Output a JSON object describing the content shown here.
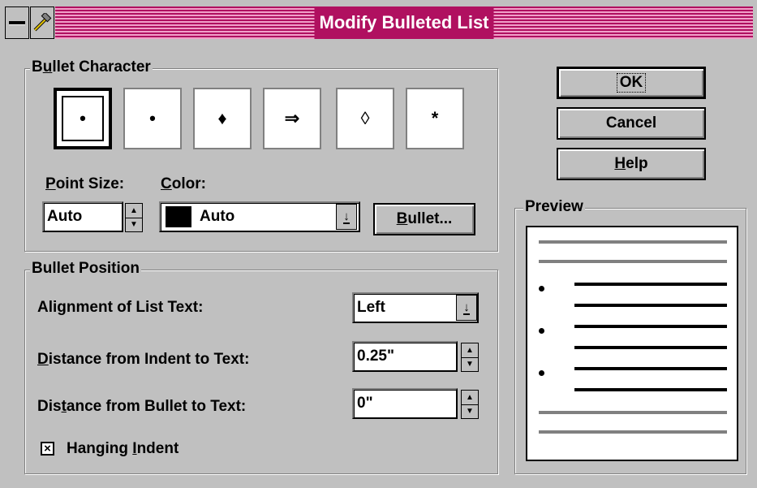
{
  "window": {
    "title": "Modify Bulleted List"
  },
  "bullet_character": {
    "group_label_pre": "B",
    "group_label_key": "u",
    "group_label_post": "llet Character",
    "bullets": [
      "•",
      "•",
      "♦",
      "⇒",
      "◊",
      "*"
    ],
    "selected_index": 0
  },
  "point_size": {
    "label_key": "P",
    "label_rest": "oint Size:",
    "value": "Auto"
  },
  "color": {
    "label_key": "C",
    "label_rest": "olor:",
    "value": "Auto",
    "swatch": "#000000"
  },
  "bullet_button": {
    "key": "B",
    "rest": "ullet..."
  },
  "bullet_position": {
    "group_label": "Bullet Position",
    "alignment": {
      "label_pre": "Ali",
      "label_key": "g",
      "label_post": "nment of List Text:",
      "value": "Left"
    },
    "indent_distance": {
      "label_key": "D",
      "label_post": "istance from Indent to Text:",
      "value": "0.25\""
    },
    "bullet_distance": {
      "label_pre": "Dis",
      "label_key": "t",
      "label_post": "ance from Bullet to Text:",
      "value": "0\""
    },
    "hanging_indent": {
      "label_pre": "Hanging ",
      "label_key": "I",
      "label_post": "ndent",
      "checked": true,
      "mark": "×"
    }
  },
  "buttons": {
    "ok": "OK",
    "cancel": "Cancel",
    "help_key": "H",
    "help_rest": "elp"
  },
  "preview": {
    "label": "Preview"
  },
  "icons": {
    "system_menu": "minus-icon",
    "app": "hammer-icon",
    "spin_up": "▲",
    "spin_down": "▼",
    "dropdown": "arrow-down-underline-icon"
  }
}
